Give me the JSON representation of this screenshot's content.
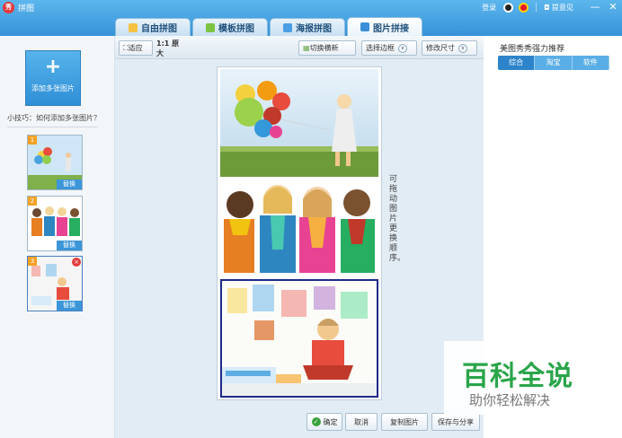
{
  "app": {
    "title": "拼图"
  },
  "titlebar": {
    "login": "登录",
    "feedback": "提意见",
    "minimize": "—",
    "close": "✕"
  },
  "tabs": [
    {
      "label": "自由拼图",
      "icon_color": "#f6c244"
    },
    {
      "label": "模板拼图",
      "icon_color": "#7cc442"
    },
    {
      "label": "海报拼图",
      "icon_color": "#4a9ee3"
    },
    {
      "label": "图片拼接",
      "icon_color": "#3a8fd8"
    }
  ],
  "left": {
    "add_button_label": "添加多张图片",
    "tip": "小技巧：如何添加多张图片？",
    "thumbs": [
      {
        "num": "1",
        "replace": "替换"
      },
      {
        "num": "2",
        "replace": "替换"
      },
      {
        "num": "3",
        "replace": "替换",
        "delete": "×"
      }
    ]
  },
  "toolbar": {
    "fit": "适应",
    "original": "1:1 原大",
    "switch_orientation": "切换横新",
    "select_border": "选择边框",
    "change_size": "修改尺寸"
  },
  "canvas": {
    "hint": "可拖动图片更换顺序。"
  },
  "bottom": {
    "ok": "确定",
    "cancel": "取消",
    "copy": "复制图片",
    "save_share": "保存与分享"
  },
  "right": {
    "title": "美图秀秀强力推荐",
    "tabs": [
      "综合",
      "淘宝",
      "软件"
    ]
  },
  "watermark": {
    "title": "百科全说",
    "subtitle": "助你轻松解决"
  }
}
